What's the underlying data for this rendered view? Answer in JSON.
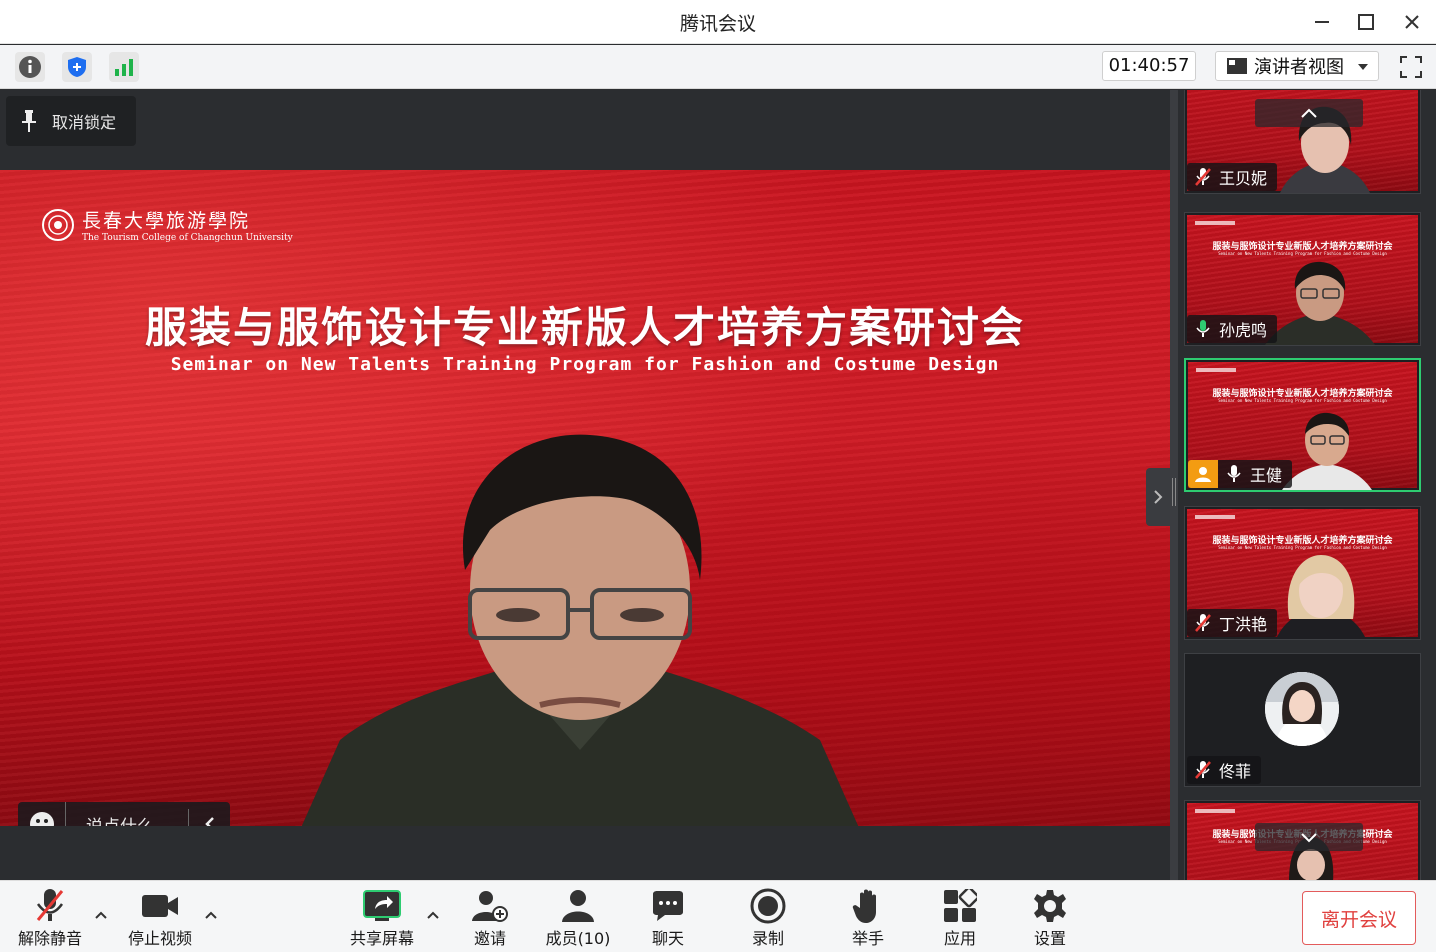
{
  "window": {
    "title": "腾讯会议"
  },
  "toolbar": {
    "timer": "01:40:57",
    "view_mode": "演讲者视图"
  },
  "stage": {
    "unpin_label": "取消锁定",
    "slide": {
      "logo_cn": "長春大學旅游學院",
      "logo_en": "The Tourism College of Changchun University",
      "title": "服装与服饰设计专业新版人才培养方案研讨会",
      "subtitle": "Seminar on New Talents Training Program for Fashion and Costume Design"
    },
    "chat_placeholder": "说点什么..."
  },
  "participants": [
    {
      "name": "王贝妮",
      "mic": "muted"
    },
    {
      "name": "孙虎鸣",
      "mic": "on"
    },
    {
      "name": "王健",
      "mic": "on",
      "active": true
    },
    {
      "name": "丁洪艳",
      "mic": "muted"
    },
    {
      "name": "佟菲",
      "mic": "muted",
      "avatar": true
    },
    {
      "name": "",
      "mic": ""
    }
  ],
  "bottombar": {
    "unmute": "解除静音",
    "stop_video": "停止视频",
    "share_screen": "共享屏幕",
    "invite": "邀请",
    "members": "成员(10)",
    "chat": "聊天",
    "record": "录制",
    "raise_hand": "举手",
    "apps": "应用",
    "settings": "设置",
    "leave": "离开会议"
  },
  "colors": {
    "active_speaker": "#2ecc71",
    "leave": "#e0403e",
    "slide_red": "#c8141f"
  }
}
